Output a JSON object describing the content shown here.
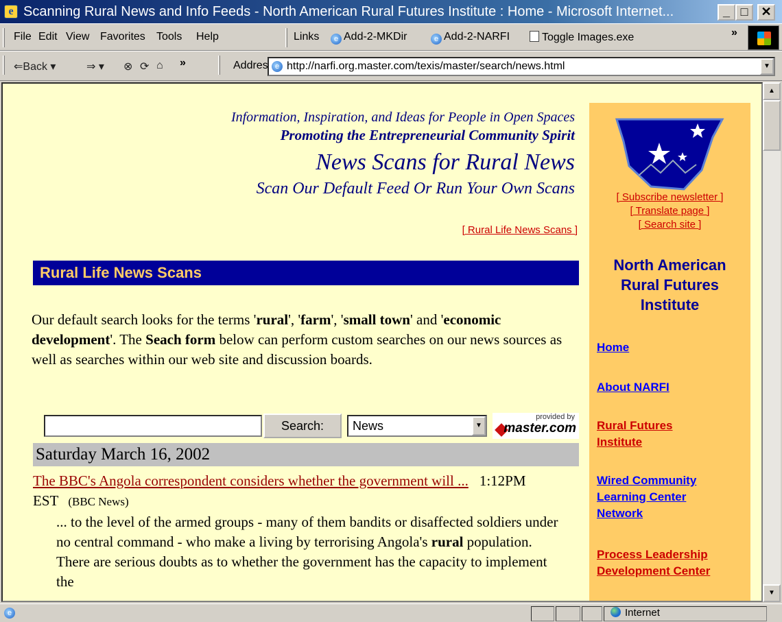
{
  "window": {
    "title": "Scanning Rural News and Info Feeds - North American Rural Futures Institute : Home - Microsoft Internet..."
  },
  "menubar": {
    "items": [
      "File",
      "Edit",
      "View",
      "Favorites",
      "Tools",
      "Help"
    ],
    "links_label": "Links",
    "links": [
      "Add-2-MKDir",
      "Add-2-NARFI",
      "Toggle Images.exe"
    ]
  },
  "addressbar": {
    "back_label": "Back",
    "address_label": "Address",
    "url": "http://narfi.org.master.com/texis/master/search/news.html"
  },
  "page": {
    "tagline": "Information, Inspiration, and Ideas for People in Open Spaces",
    "slogan": "Promoting the Entrepreneurial Community Spirit",
    "heading": "News Scans for Rural News",
    "subheading": "Scan Our Default Feed Or Run Your Own Scans",
    "top_link": "[ Rural Life News Scans ]",
    "section_title": "Rural Life News Scans",
    "intro": {
      "p1": "Our default search looks for the terms '",
      "t1": "rural",
      "p2": "', '",
      "t2": "farm",
      "p3": "', '",
      "t3": "small town",
      "p4": "' and '",
      "t4": "economic development",
      "p5": "'. The ",
      "t5": "Seach form",
      "p6": " below can perform custom searches on our news sources as well as searches within our web site and discussion boards."
    },
    "search": {
      "input_value": "",
      "button_label": "Search:",
      "scope_selected": "News",
      "provided_by": "provided by",
      "provider": "master.com"
    },
    "date_header": "Saturday March 16, 2002",
    "news_item": {
      "title": "The BBC's Angola correspondent considers whether the government will ...",
      "time": "1:12PM EST",
      "source": "(BBC News)",
      "snippet_before": "... to the level of the armed groups - many of them bandits or disaffected soldiers under no central command - who make a living by terrorising Angola's ",
      "snippet_bold": "rural",
      "snippet_after": " population. There are serious doubts as to whether the government has the capacity to implement the"
    }
  },
  "sidebar": {
    "links": [
      "[ Subscribe newsletter ]",
      "[ Translate page ]",
      "[ Search site ]"
    ],
    "org_name": [
      "North American",
      "Rural Futures",
      "Institute"
    ],
    "nav": [
      {
        "label": "Home",
        "color": "#0000ff"
      },
      {
        "label": "About NARFI",
        "color": "#0000ff"
      },
      {
        "label": "Rural Futures Institute",
        "color": "#cc0000"
      },
      {
        "label": "Wired Community Learning Center Network",
        "color": "#0000ff"
      },
      {
        "label": "Process Leadership Development Center",
        "color": "#cc0000"
      }
    ]
  },
  "statusbar": {
    "zone": "Internet"
  },
  "colors": {
    "page_bg": "#ffffcc",
    "sidebar_bg": "#ffcc66",
    "section_bar": "#000099",
    "section_text": "#ffcc66",
    "link_red": "#cc0000",
    "link_blue": "#0000ff"
  },
  "icons": [
    "ie-logo-icon",
    "back-arrow-icon",
    "forward-arrow-icon",
    "stop-icon",
    "refresh-icon",
    "home-icon",
    "globe-icon",
    "windows-flag-icon"
  ]
}
